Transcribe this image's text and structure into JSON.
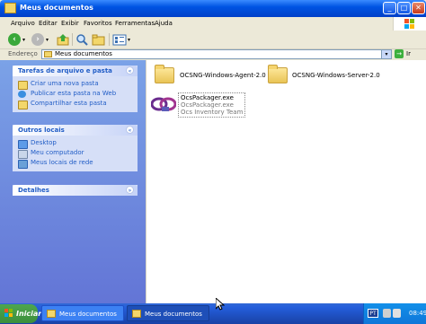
{
  "window": {
    "title": "Meus documentos",
    "buttons": {
      "minimize": "_",
      "maximize": "□",
      "close": "✕"
    }
  },
  "menu": {
    "items": [
      "Arquivo",
      "Editar",
      "Exibir",
      "Favoritos",
      "Ferramentas",
      "Ajuda"
    ]
  },
  "toolbar": {
    "back_icon": "back-arrow",
    "forward_icon": "forward-arrow",
    "up_icon": "up-folder",
    "search_icon": "search",
    "folders_icon": "folders",
    "views_icon": "views"
  },
  "address": {
    "label": "Endereço",
    "value": "Meus documentos",
    "go_label": "Ir"
  },
  "sidebar": {
    "panels": [
      {
        "title": "Tarefas de arquivo e pasta",
        "chevron": "«",
        "links": [
          "Criar uma nova pasta",
          "Publicar esta pasta na Web",
          "Compartilhar esta pasta"
        ]
      },
      {
        "title": "Outros locais",
        "chevron": "«",
        "links": [
          "Desktop",
          "Meu computador",
          "Meus locais de rede"
        ]
      },
      {
        "title": "Detalhes",
        "chevron": "»",
        "links": []
      }
    ]
  },
  "files": [
    {
      "name": "OCSNG-Windows-Agent-2.0",
      "type": "folder"
    },
    {
      "name": "OCSNG-Windows-Server-2.0",
      "type": "folder"
    },
    {
      "name": "OcsPackager.exe",
      "type": "exe",
      "line2": "OcsPackager.exe",
      "line3": "Ocs Inventory Team"
    }
  ],
  "taskbar": {
    "start_label": "Iniciar",
    "buttons": [
      "Meus documentos",
      "Meus documentos"
    ],
    "lang": "PT",
    "clock": "08:49"
  },
  "colors": {
    "titlebar": "#0054e3",
    "sidebar": "#6d8ddf",
    "link": "#215dc6",
    "taskbar": "#245edb",
    "start": "#3c8f3c"
  }
}
